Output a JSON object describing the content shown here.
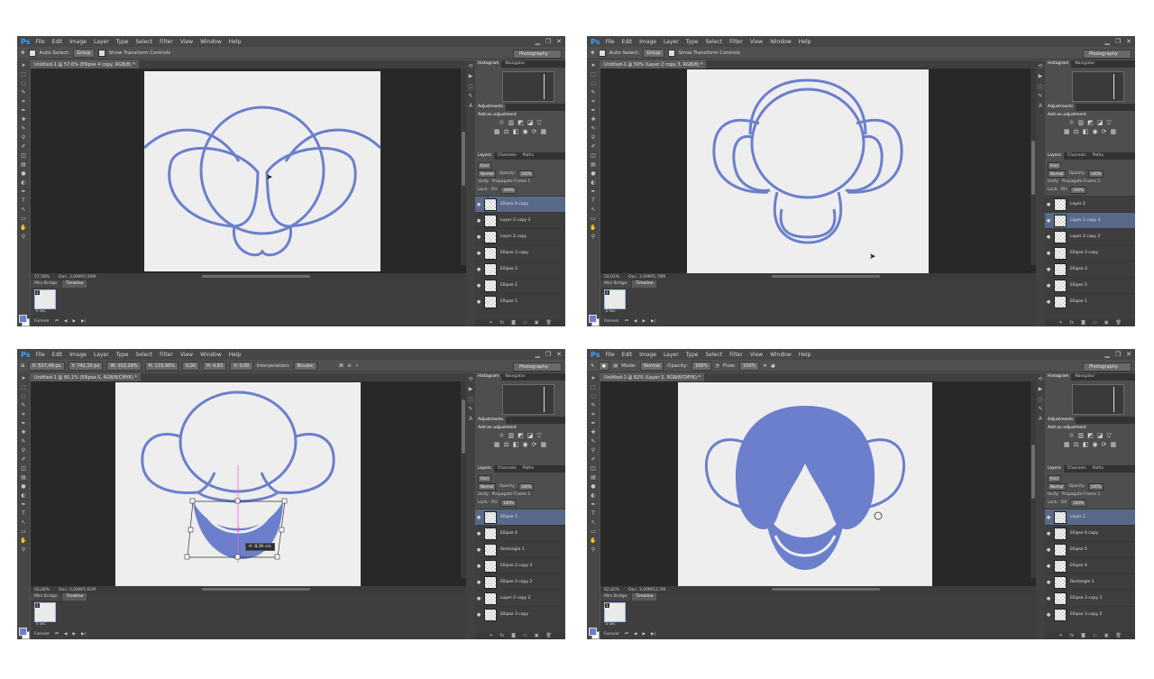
{
  "menu": [
    "File",
    "Edit",
    "Image",
    "Layer",
    "Type",
    "Select",
    "Filter",
    "View",
    "Window",
    "Help"
  ],
  "colors": {
    "accent": "#6b7fcc",
    "canvas": "#eeeeef",
    "selected_layer": "#59698a"
  },
  "panels": {
    "histogram_tab": "Histogram",
    "navigator_tab": "Navigator",
    "adjustments_tab": "Adjustments",
    "add_adjustment": "Add an adjustment",
    "layers_tab": "Layers",
    "channels_tab": "Channels",
    "paths_tab": "Paths",
    "kind": "Kind",
    "opacity_label": "Opacity:",
    "opacity_value": "100%",
    "unify_label": "Unify:",
    "propagate": "Propagate Frame 1",
    "lock_label": "Lock:",
    "fill_label": "Fill:",
    "fill_value": "100%"
  },
  "timeline": {
    "minibridge_tab": "Mini Bridge",
    "timeline_tab": "Timeline",
    "frame_num": "1",
    "frame_time": "0 sec.",
    "loop": "Forever"
  },
  "windows": [
    {
      "options": {
        "auto_select": "Auto-Select:",
        "group": "Group",
        "transform": "Show Transform Controls"
      },
      "workspace": "Photography",
      "doc_tab": "Untitled-1 @ 57,6% (Ellipse 4 copy, RGB/8) *",
      "zoom": "57,58%",
      "doc_size": "Doc: 3,00M/5,00M",
      "blend": "Normal",
      "layers": [
        "Ellipse 4 copy",
        "Layer 2 copy 3",
        "Layer 2 copy",
        "Ellipse 3 copy",
        "Ellipse 3",
        "Ellipse 2",
        "Ellipse 1"
      ]
    },
    {
      "options": {
        "auto_select": "Auto-Select:",
        "group": "Group",
        "transform": "Show Transform Controls"
      },
      "workspace": "Photography",
      "doc_tab": "Untitled-1 @ 59% (Layer 2 copy 3, RGB/8) *",
      "zoom": "59,01%",
      "doc_size": "Doc: 3,00M/5,78M",
      "blend": "Normal",
      "layers": [
        "Layer 2",
        "Layer 2 copy 3",
        "Layer 2 copy 2",
        "Ellipse 3 copy",
        "Ellipse 3",
        "Ellipse 2",
        "Ellipse 1"
      ]
    },
    {
      "options": {
        "x": "X: 557,49 px",
        "y": "Y: 742,10 px",
        "w": "W: 102,29%",
        "h": "H: 133,90%",
        "angle": "0,00",
        "hs": "H: 4,83",
        "vs": "V: 0,00",
        "interpolation": "Interpolation:",
        "bicubic": "Bicubic"
      },
      "workspace": "Photography",
      "doc_tab": "Untitled-1 @ 60,1% (Ellipse 5, RGB/8/CMYK) *",
      "zoom": "60,08%",
      "doc_size": "Doc: 3,00M/5,61M",
      "blend": "Normal",
      "height_tip": "H: 8,36 cm",
      "layers": [
        "Ellipse 5",
        "Ellipse 4",
        "Rectangle 1",
        "Ellipse 3 copy 3",
        "Ellipse 3 copy 2",
        "Layer 2 copy 2",
        "Ellipse 3 copy"
      ]
    },
    {
      "options": {
        "mode_label": "Mode:",
        "mode": "Normal",
        "opacity_label": "Opacity:",
        "opacity": "100%",
        "flow_label": "Flow:",
        "flow": "100%"
      },
      "workspace": "Photography",
      "doc_tab": "Untitled-1 @ 62% (Layer 2, RGB/8/CMYK) *",
      "zoom": "62,02%",
      "doc_size": "Doc: 3,00M/12,5M",
      "blend": "Normal",
      "layers": [
        "Layer 2",
        "Ellipse 6 copy",
        "Ellipse 5",
        "Ellipse 4",
        "Rectangle 1",
        "Ellipse 3 copy 3",
        "Ellipse 3 copy 2"
      ]
    }
  ]
}
